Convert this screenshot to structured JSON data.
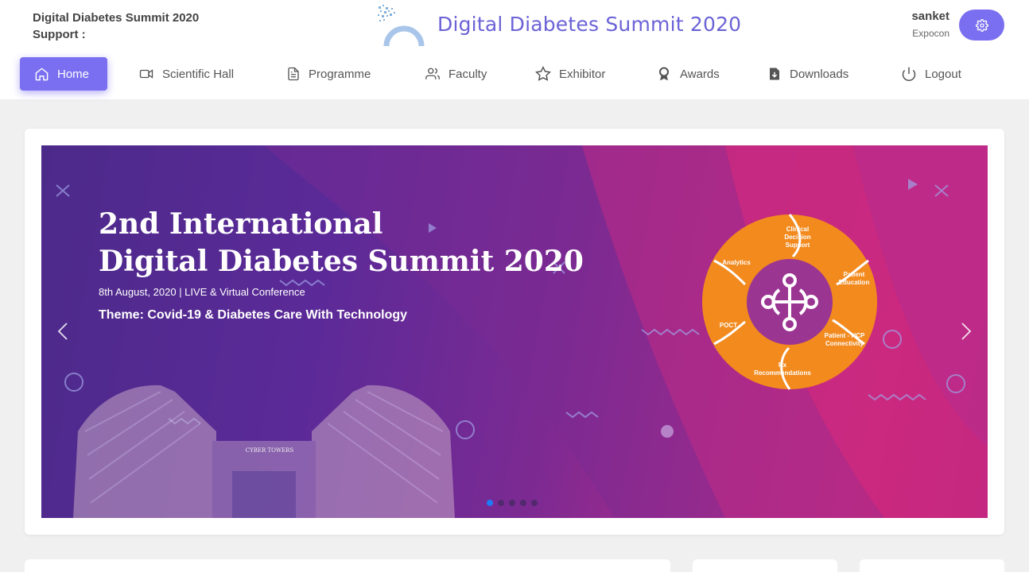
{
  "header": {
    "left_title": "Digital Diabetes Summit 2020",
    "support_label": "Support :",
    "site_title": "Digital Diabetes Summit 2020",
    "user_name": "sanket",
    "user_org": "Expocon"
  },
  "nav": [
    {
      "label": "Home",
      "icon": "home-icon",
      "active": true
    },
    {
      "label": "Scientific Hall",
      "icon": "video-icon"
    },
    {
      "label": "Programme",
      "icon": "document-icon"
    },
    {
      "label": "Faculty",
      "icon": "users-icon"
    },
    {
      "label": "Exhibitor",
      "icon": "star-icon"
    },
    {
      "label": "Awards",
      "icon": "award-icon"
    },
    {
      "label": "Downloads",
      "icon": "download-file-icon"
    },
    {
      "label": "Logout",
      "icon": "power-icon"
    }
  ],
  "banner": {
    "heading_line1": "2nd International",
    "heading_line2": "Digital Diabetes Summit 2020",
    "date_line": "8th  August, 2020 | LIVE & Virtual Conference",
    "theme": "Theme: Covid-19 & Diabetes Care With Technology",
    "wheel_segments": [
      "Clinical Decision Support",
      "Patient Education",
      "Patient - HCP Connectivity",
      "Rx Recommendations",
      "POCT",
      "Analytics"
    ],
    "building_sign": "CYBER TOWERS",
    "slide_count": 5,
    "active_slide": 1
  },
  "colors": {
    "accent": "#7a6ff0",
    "title": "#6b63d6",
    "wheel": "#f28a1e",
    "active_dot": "#1f7cf4"
  }
}
